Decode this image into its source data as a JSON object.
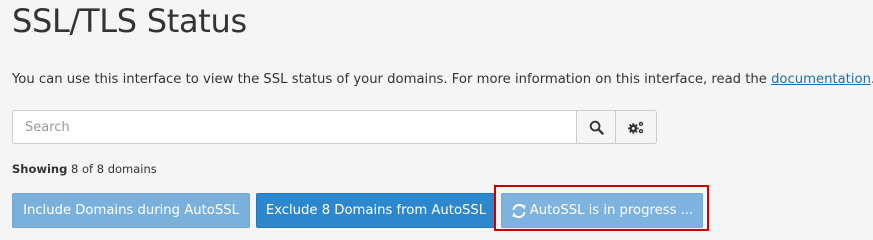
{
  "page": {
    "title": "SSL/TLS Status",
    "description_prefix": "You can use this interface to view the SSL status of your domains. For more information on this interface, read the ",
    "description_link": "documentation",
    "description_suffix": "."
  },
  "search": {
    "placeholder": "Search",
    "value": "",
    "search_icon": "search-icon",
    "settings_icon": "gears-icon"
  },
  "status": {
    "showing_label": "Showing",
    "showing_count": "8 of 8 domains"
  },
  "actions": {
    "include_label": "Include Domains during AutoSSL",
    "exclude_label": "Exclude 8 Domains from AutoSSL",
    "autossl_label": "AutoSSL is in progress ...",
    "autossl_icon": "refresh-icon"
  },
  "colors": {
    "include_button": "#79b0dc",
    "exclude_button": "#2c87cd",
    "autossl_button": "#7db3de",
    "link": "#1f6fa8",
    "highlight": "#cc0000"
  }
}
